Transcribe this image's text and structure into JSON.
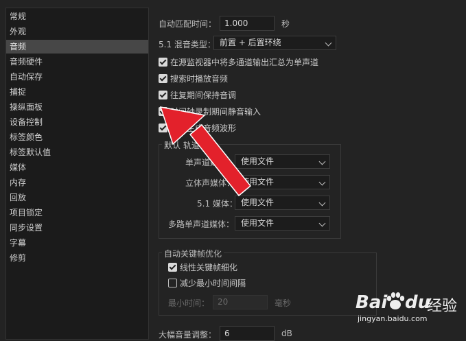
{
  "sidebar": {
    "items": [
      {
        "label": "常规"
      },
      {
        "label": "外观"
      },
      {
        "label": "音频",
        "selected": true
      },
      {
        "label": "音频硬件"
      },
      {
        "label": "自动保存"
      },
      {
        "label": "捕捉"
      },
      {
        "label": "操纵面板"
      },
      {
        "label": "设备控制"
      },
      {
        "label": "标签颜色"
      },
      {
        "label": "标签默认值"
      },
      {
        "label": "媒体"
      },
      {
        "label": "内存"
      },
      {
        "label": "回放"
      },
      {
        "label": "项目锁定"
      },
      {
        "label": "同步设置"
      },
      {
        "label": "字幕"
      },
      {
        "label": "修剪"
      }
    ]
  },
  "audio": {
    "auto_match_label": "自动匹配时间：",
    "auto_match_value": "1.000",
    "auto_match_unit": "秒",
    "mix_label": "5.1 混音类型：",
    "mix_value": "前置 + 后置环绕",
    "checkboxes": [
      {
        "label": "在源监视器中将多通道输出汇总为单声道",
        "checked": true
      },
      {
        "label": "搜索时播放音频",
        "checked": true
      },
      {
        "label": "往复期间保持音调",
        "checked": true
      },
      {
        "label": "时间轴录制期间静音输入",
        "checked": true
      },
      {
        "label": "动生成音频波形",
        "checked": true
      }
    ],
    "default_tracks": {
      "title": "默认 轨道",
      "rows": [
        {
          "label": "单声道媒体：",
          "value": "使用文件"
        },
        {
          "label": "立体声媒体：",
          "value": "使用文件"
        },
        {
          "label": "5.1 媒体：",
          "value": "使用文件"
        },
        {
          "label": "多路单声道媒体：",
          "value": "使用文件"
        }
      ]
    },
    "keyframe": {
      "title": "自动关键帧优化",
      "linear_label": "线性关键帧细化",
      "linear_checked": true,
      "reduce_label": "减少最小时间间隔",
      "reduce_checked": false,
      "min_time_label": "最小时间：",
      "min_time_value": "20",
      "min_time_unit": "毫秒"
    },
    "gain_label": "大幅音量调整：",
    "gain_value": "6",
    "gain_unit": "dB"
  },
  "watermark": {
    "brand": "Bai",
    "brand2": "du",
    "suffix": "经验",
    "url": "jingyan.baidu.com"
  },
  "colors": {
    "background": "#232323",
    "sidebar": "#1b1b1b",
    "selected": "#474747",
    "arrow": "#e3212b"
  }
}
